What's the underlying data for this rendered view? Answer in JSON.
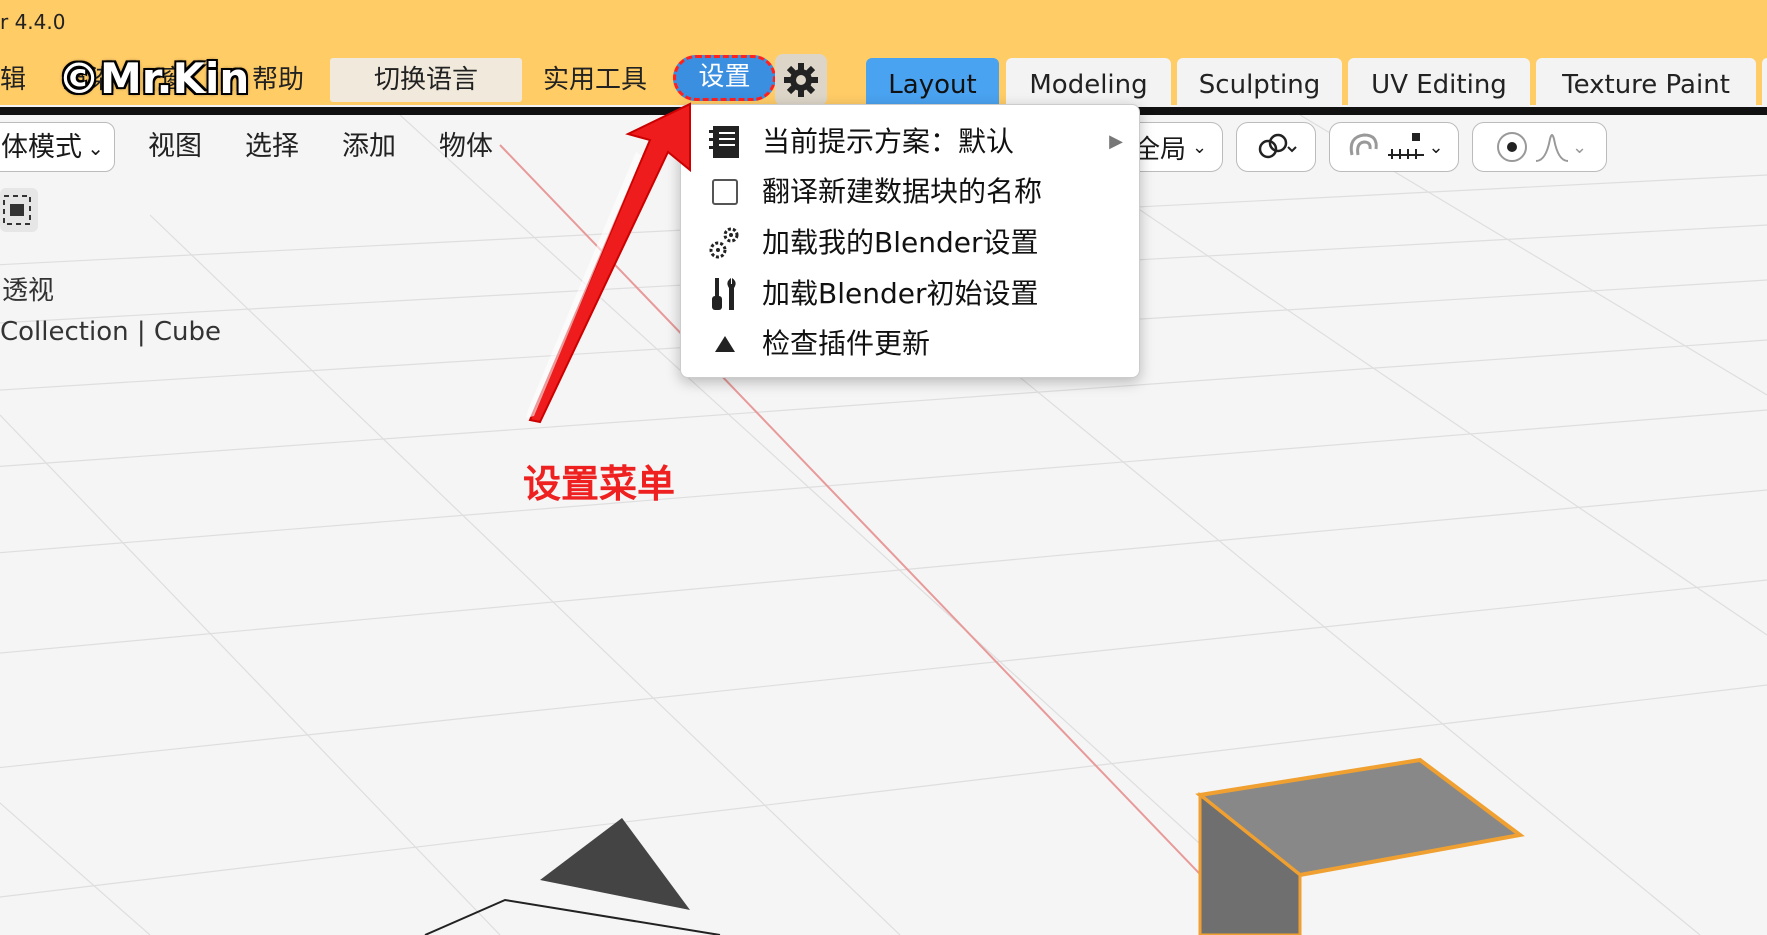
{
  "window": {
    "title": "r 4.4.0"
  },
  "watermark": "©Mr.Kin",
  "menubar": {
    "items": [
      "辑",
      "渲染",
      "窗",
      "帮助"
    ],
    "switch_language": "切换语言",
    "utilities": "实用工具",
    "settings": "设置"
  },
  "workspace_tabs": [
    "Layout",
    "Modeling",
    "Sculpting",
    "UV Editing",
    "Texture Paint"
  ],
  "viewport_header": {
    "mode": "体模式",
    "menus": [
      "视图",
      "选择",
      "添加",
      "物体"
    ],
    "transform_orientation": "全局"
  },
  "viewport_overlay": {
    "view_name": "透视",
    "collection_path": "Collection | Cube"
  },
  "settings_menu": {
    "items": [
      {
        "label": "当前提示方案：默认",
        "icon": "notebook-icon",
        "has_submenu": true
      },
      {
        "label": "翻译新建数据块的名称",
        "icon": "checkbox-icon",
        "checked": false
      },
      {
        "label": "加载我的Blender设置",
        "icon": "gears-icon"
      },
      {
        "label": "加载Blender初始设置",
        "icon": "tools-icon"
      },
      {
        "label": "检查插件更新",
        "icon": "triangle-up-icon"
      }
    ]
  },
  "annotation": {
    "label": "设置菜单",
    "color": "#ee2020"
  },
  "colors": {
    "header_bg": "#ffcc66",
    "active_tab": "#4aa3f0",
    "settings_button": "#3b8fe0",
    "selection_outline": "#f0a030"
  }
}
